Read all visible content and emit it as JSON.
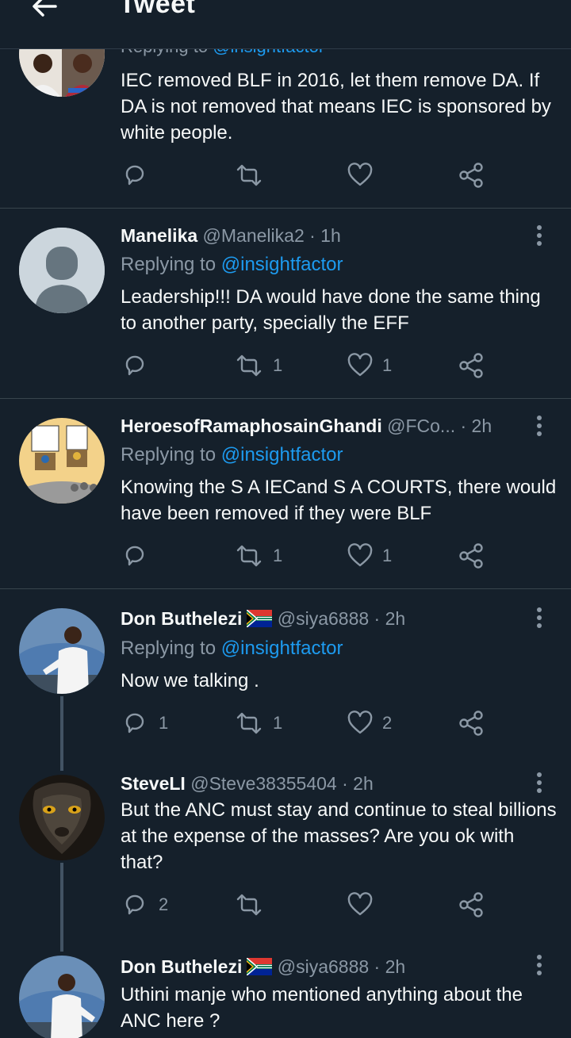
{
  "header": {
    "title": "Tweet"
  },
  "tweets": [
    {
      "name": "",
      "handle": "",
      "time": "",
      "replying_prefix": "Replying to",
      "replying_handle": "@insightfactor",
      "text": "IEC removed BLF in 2016, let them remove DA. If DA is not removed that means IEC is sponsored by white people.",
      "replies": "",
      "retweets": "",
      "likes": ""
    },
    {
      "name": "Manelika",
      "handle": "@Manelika2",
      "time": "· 1h",
      "replying_prefix": "Replying to",
      "replying_handle": "@insightfactor",
      "text": "Leadership!!! DA would have done the same thing to another party, specially the EFF",
      "replies": "",
      "retweets": "1",
      "likes": "1"
    },
    {
      "name": "HeroesofRamaphosainGhandi",
      "handle": "@FCo...",
      "time": "· 2h",
      "replying_prefix": "Replying to",
      "replying_handle": "@insightfactor",
      "text": "Knowing the S A IECand S A COURTS, there would have been removed if they were BLF",
      "replies": "",
      "retweets": "1",
      "likes": "1"
    },
    {
      "name": "Don Buthelezi",
      "handle": "@siya6888",
      "time": "· 2h",
      "replying_prefix": "Replying to",
      "replying_handle": "@insightfactor",
      "text": "Now we talking .",
      "replies": "1",
      "retweets": "1",
      "likes": "2"
    },
    {
      "name": "SteveLI",
      "handle": "@Steve38355404",
      "time": "· 2h",
      "text": "But the ANC must stay and continue to steal billions at the expense of the masses? Are you ok with that?",
      "replies": "2",
      "retweets": "",
      "likes": ""
    },
    {
      "name": "Don Buthelezi",
      "handle": "@siya6888",
      "time": "· 2h",
      "text": "Uthini manje who mentioned anything about the ANC here ?"
    }
  ],
  "icons": {
    "back": "arrow-left-icon",
    "reply": "reply-icon",
    "retweet": "retweet-icon",
    "like": "heart-icon",
    "share": "share-icon",
    "more": "more-vertical-icon",
    "flag": "south-africa-flag-icon"
  },
  "colors": {
    "background": "#15202b",
    "accent": "#1d9bf0",
    "secondary_text": "#8b98a5",
    "separator": "#38444d"
  }
}
